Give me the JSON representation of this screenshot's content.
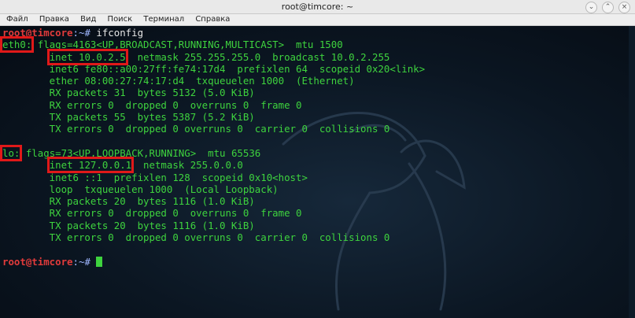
{
  "window": {
    "title": "root@timcore: ~",
    "buttons": [
      "⌄",
      "⌃",
      "×"
    ]
  },
  "menu": [
    "Файл",
    "Правка",
    "Вид",
    "Поиск",
    "Терминал",
    "Справка"
  ],
  "terminal": {
    "prompt_user": "root@timcore",
    "prompt_path": ":~#",
    "command": " ifconfig",
    "eth0": {
      "name": "eth0:",
      "flags": " flags=4163<UP,BROADCAST,RUNNING,MULTICAST>  mtu 1500",
      "indent": "        ",
      "inet": "inet 10.0.2.5",
      "inet_rest": "  netmask 255.255.255.0  broadcast 10.0.2.255",
      "lines": [
        "        inet6 fe80::a00:27ff:fe74:17d4  prefixlen 64  scopeid 0x20<link>",
        "        ether 08:00:27:74:17:d4  txqueuelen 1000  (Ethernet)",
        "        RX packets 31  bytes 5132 (5.0 KiB)",
        "        RX errors 0  dropped 0  overruns 0  frame 0",
        "        TX packets 55  bytes 5387 (5.2 KiB)",
        "        TX errors 0  dropped 0 overruns 0  carrier 0  collisions 0"
      ]
    },
    "lo": {
      "name": "lo:",
      "flags": " flags=73<UP,LOOPBACK,RUNNING>  mtu 65536",
      "indent": "        ",
      "inet": "inet 127.0.0.1",
      "inet_rest": "  netmask 255.0.0.0",
      "lines": [
        "        inet6 ::1  prefixlen 128  scopeid 0x10<host>",
        "        loop  txqueuelen 1000  (Local Loopback)",
        "        RX packets 20  bytes 1116 (1.0 KiB)",
        "        RX errors 0  dropped 0  overruns 0  frame 0",
        "        TX packets 20  bytes 1116 (1.0 KiB)",
        "        TX errors 0  dropped 0 overruns 0  carrier 0  collisions 0"
      ]
    }
  },
  "colors": {
    "text_green": "#3ed33e",
    "prompt_red": "#e23b3b",
    "highlight_box": "#e01919"
  }
}
